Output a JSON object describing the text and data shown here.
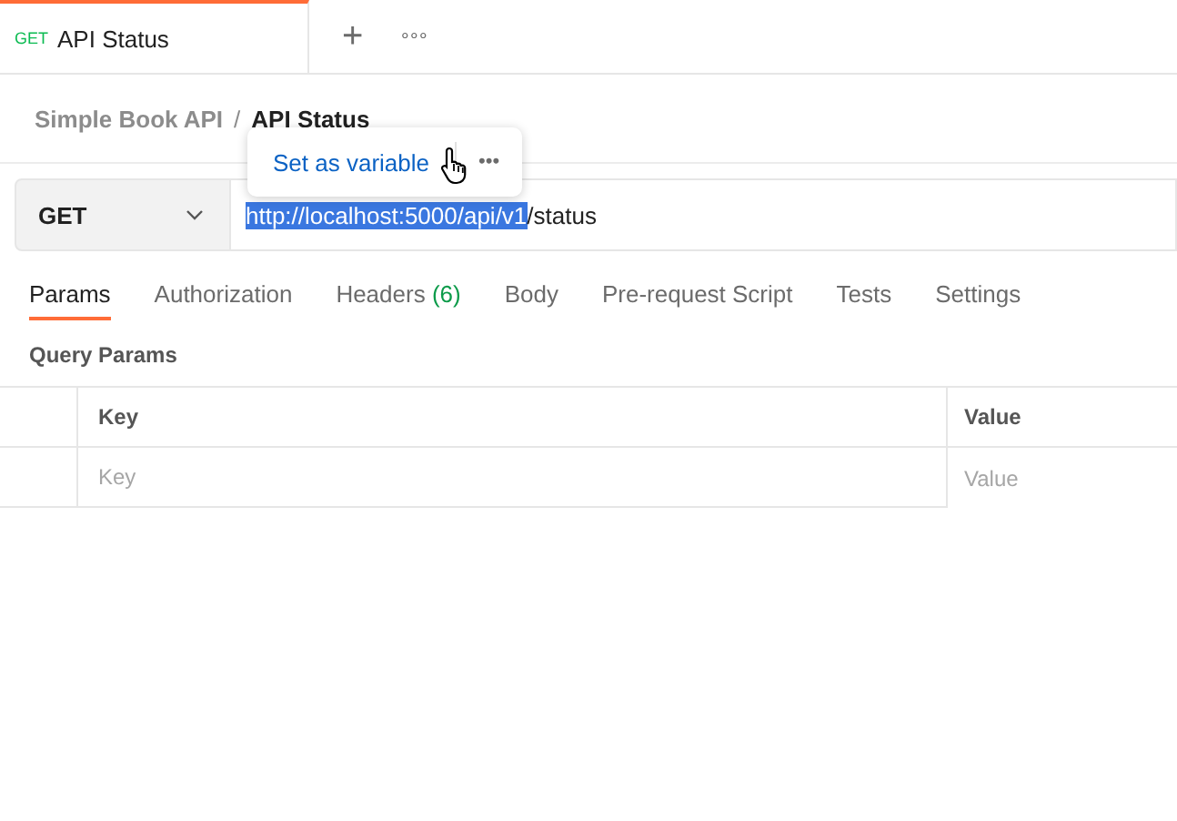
{
  "tabs": [
    {
      "method": "GET",
      "label": "API Status",
      "selected": true
    }
  ],
  "tab_bar": {
    "add": "+",
    "more": "∘∘∘"
  },
  "breadcrumb": {
    "collection": "Simple Book API",
    "separator": "/",
    "request": "API Status"
  },
  "popup": {
    "action": "Set as variable",
    "more": "•••"
  },
  "request": {
    "method": "GET",
    "url_selected": "http://localhost:5000/api/v1",
    "url_rest": "/status"
  },
  "request_tabs": [
    {
      "label": "Params",
      "selected": true
    },
    {
      "label": "Authorization",
      "selected": false
    },
    {
      "label": "Headers",
      "count": "(6)",
      "selected": false
    },
    {
      "label": "Body",
      "selected": false
    },
    {
      "label": "Pre-request Script",
      "selected": false
    },
    {
      "label": "Tests",
      "selected": false
    },
    {
      "label": "Settings",
      "selected": false
    }
  ],
  "section_title": "Query Params",
  "table": {
    "columns": [
      "Key",
      "Value"
    ],
    "placeholders": [
      "Key",
      "Value"
    ]
  }
}
